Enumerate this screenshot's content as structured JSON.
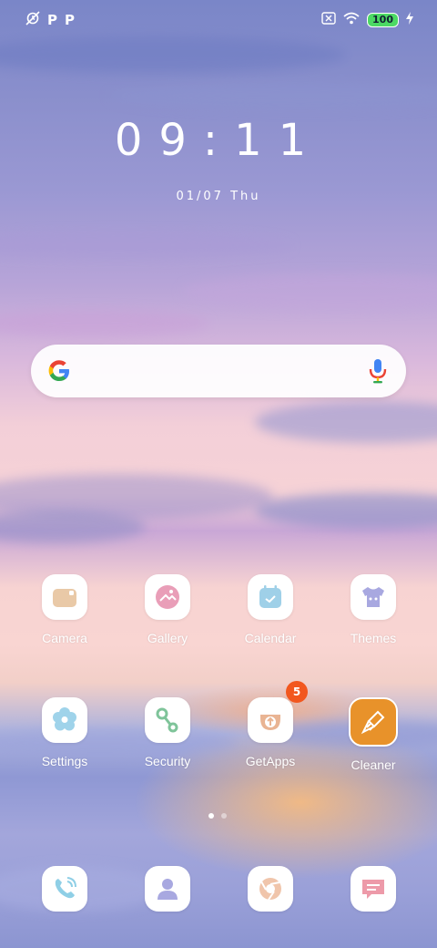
{
  "status_bar": {
    "left_icons": [
      "silent-alarm-icon",
      "p-notification-icon",
      "p-notification-icon"
    ],
    "p_letter": "P",
    "battery_level": "100",
    "right_icons": [
      "no-sim-icon",
      "wifi-icon",
      "battery-icon",
      "charging-icon"
    ]
  },
  "clock": {
    "time": "09:11",
    "date": "01/07 Thu"
  },
  "search": {
    "left_icon": "google-logo-icon",
    "right_icon": "mic-icon"
  },
  "apps_row1": [
    {
      "label": "Camera",
      "icon": "camera-icon"
    },
    {
      "label": "Gallery",
      "icon": "gallery-icon"
    },
    {
      "label": "Calendar",
      "icon": "calendar-icon"
    },
    {
      "label": "Themes",
      "icon": "themes-icon"
    }
  ],
  "apps_row2": [
    {
      "label": "Settings",
      "icon": "settings-icon"
    },
    {
      "label": "Security",
      "icon": "security-icon"
    },
    {
      "label": "GetApps",
      "icon": "getapps-icon",
      "badge": "5"
    },
    {
      "label": "Cleaner",
      "icon": "cleaner-icon"
    }
  ],
  "dock": [
    {
      "icon": "phone-icon"
    },
    {
      "icon": "contacts-icon"
    },
    {
      "icon": "browser-icon"
    },
    {
      "icon": "messages-icon"
    }
  ],
  "page_indicator": {
    "pages": 2,
    "current": 1
  },
  "colors": {
    "accent_orange": "#f2571e",
    "cleaner_orange": "#e8922a",
    "tile_bg": "#ffffff"
  }
}
